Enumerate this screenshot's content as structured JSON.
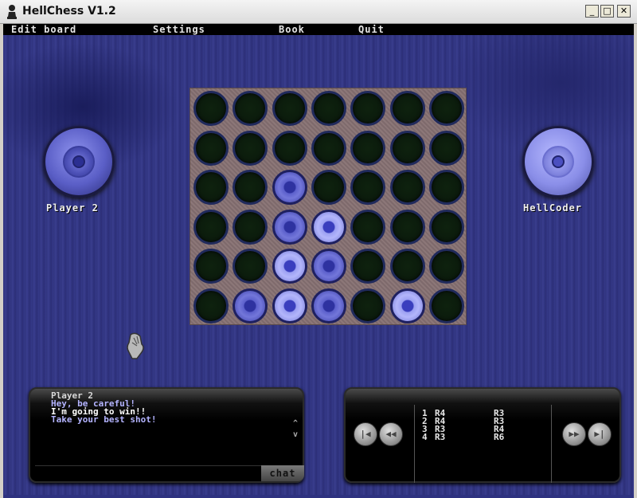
{
  "window": {
    "title": "HellChess V1.2",
    "minimize": "_",
    "maximize": "□",
    "close": "✕"
  },
  "menu": [
    "Edit board",
    "Settings",
    "Book",
    "Quit"
  ],
  "players": {
    "left": "Player 2",
    "right": "HellCoder"
  },
  "board": {
    "rows": 6,
    "cols": 7,
    "cells": [
      [
        "",
        "",
        "",
        "",
        "",
        "",
        ""
      ],
      [
        "",
        "",
        "",
        "",
        "",
        "",
        ""
      ],
      [
        "",
        "",
        "p1",
        "",
        "",
        "",
        ""
      ],
      [
        "",
        "",
        "p1",
        "p2",
        "",
        "",
        ""
      ],
      [
        "",
        "",
        "p2",
        "p1",
        "",
        "",
        ""
      ],
      [
        "",
        "p1",
        "p2",
        "p1",
        "",
        "p2",
        ""
      ]
    ]
  },
  "chat": {
    "lines": [
      "Player 2",
      "Hey, be careful!",
      "I'm going to win!!",
      "Take your best shot!"
    ],
    "input": "",
    "button": "chat",
    "scroll_up": "^",
    "scroll_down": "v"
  },
  "moves": [
    {
      "n": "1",
      "a": "R4",
      "b": "R3"
    },
    {
      "n": "2",
      "a": "R4",
      "b": "R3"
    },
    {
      "n": "3",
      "a": "R3",
      "b": "R4"
    },
    {
      "n": "4",
      "a": "R3",
      "b": "R6"
    }
  ],
  "nav": {
    "first": "|◀",
    "prev": "◀◀",
    "next": "▶▶",
    "last": "▶|"
  }
}
